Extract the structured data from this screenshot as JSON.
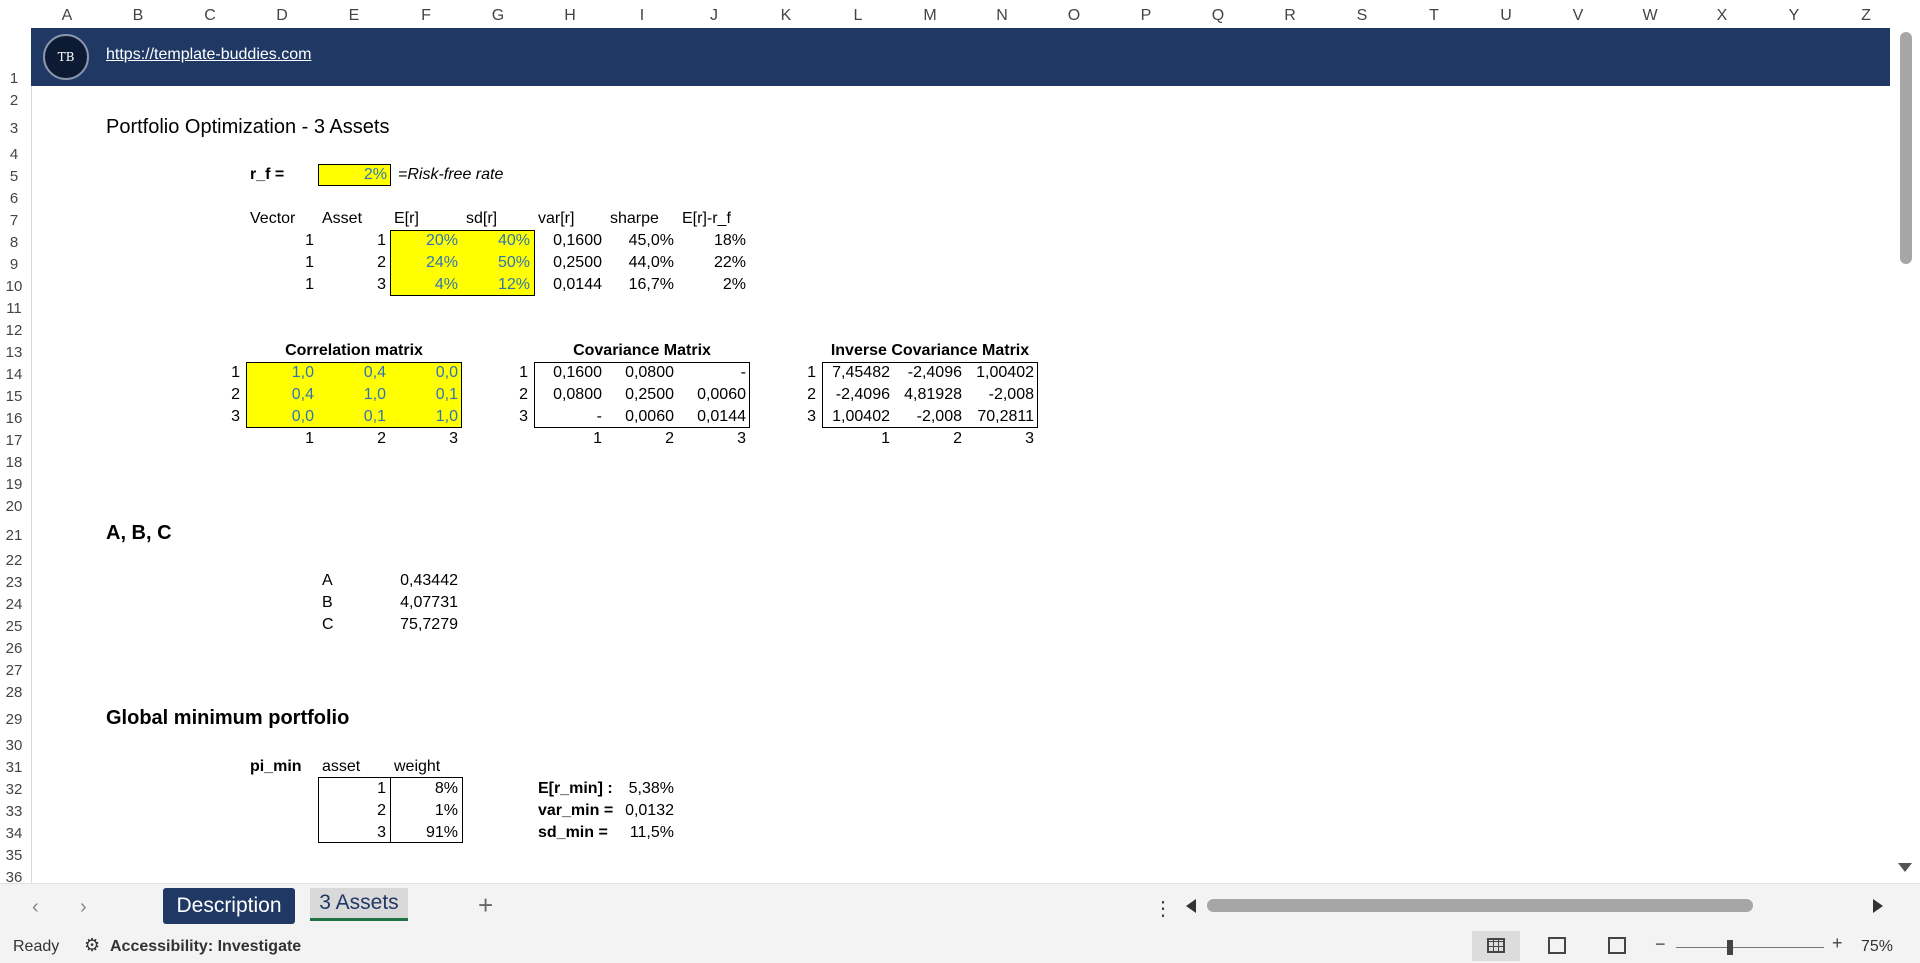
{
  "columns": [
    "A",
    "B",
    "C",
    "D",
    "E",
    "F",
    "G",
    "H",
    "I",
    "J",
    "K",
    "L",
    "M",
    "N",
    "O",
    "P",
    "Q",
    "R",
    "S",
    "T",
    "U",
    "V",
    "W",
    "X",
    "Y",
    "Z"
  ],
  "rows": [
    "1",
    "2",
    "3",
    "4",
    "5",
    "6",
    "7",
    "8",
    "9",
    "10",
    "11",
    "12",
    "13",
    "14",
    "15",
    "16",
    "17",
    "18",
    "19",
    "20",
    "21",
    "22",
    "23",
    "24",
    "25",
    "26",
    "27",
    "28",
    "29",
    "30",
    "31",
    "32",
    "33",
    "34",
    "35",
    "36"
  ],
  "banner": {
    "logo_text": "TB",
    "url": "https://template-buddies.com"
  },
  "title": "Portfolio Optimization - 3 Assets",
  "rf": {
    "label": "r_f =",
    "value": "2%",
    "note": "=Risk-free rate"
  },
  "assets_table": {
    "headers": [
      "Vector",
      "Asset",
      "E[r]",
      "sd[r]",
      "var[r]",
      "sharpe",
      "E[r]-r_f"
    ],
    "rows": [
      [
        "1",
        "1",
        "20%",
        "40%",
        "0,1600",
        "45,0%",
        "18%"
      ],
      [
        "1",
        "2",
        "24%",
        "50%",
        "0,2500",
        "44,0%",
        "22%"
      ],
      [
        "1",
        "3",
        "4%",
        "12%",
        "0,0144",
        "16,7%",
        "2%"
      ]
    ]
  },
  "correlation": {
    "title": "Correlation matrix",
    "row_labels": [
      "1",
      "2",
      "3"
    ],
    "col_labels": [
      "1",
      "2",
      "3"
    ],
    "cells": [
      [
        "1,0",
        "0,4",
        "0,0"
      ],
      [
        "0,4",
        "1,0",
        "0,1"
      ],
      [
        "0,0",
        "0,1",
        "1,0"
      ]
    ]
  },
  "covariance": {
    "title": "Covariance Matrix",
    "row_labels": [
      "1",
      "2",
      "3"
    ],
    "col_labels": [
      "1",
      "2",
      "3"
    ],
    "cells": [
      [
        "0,1600",
        "0,0800",
        "-"
      ],
      [
        "0,0800",
        "0,2500",
        "0,0060"
      ],
      [
        "-",
        "0,0060",
        "0,0144"
      ]
    ]
  },
  "inverse": {
    "title": "Inverse Covariance Matrix",
    "row_labels": [
      "1",
      "2",
      "3"
    ],
    "col_labels": [
      "1",
      "2",
      "3"
    ],
    "cells": [
      [
        "7,45482",
        "-2,4096",
        "1,00402"
      ],
      [
        "-2,4096",
        "4,81928",
        "-2,008"
      ],
      [
        "1,00402",
        "-2,008",
        "70,2811"
      ]
    ]
  },
  "abc": {
    "title": "A, B, C",
    "rows": [
      [
        "A",
        "0,43442"
      ],
      [
        "B",
        "4,07731"
      ],
      [
        "C",
        "75,7279"
      ]
    ]
  },
  "gmp": {
    "title": "Global minimum portfolio",
    "label": "pi_min",
    "headers": [
      "asset",
      "weight"
    ],
    "rows": [
      [
        "1",
        "8%"
      ],
      [
        "2",
        "1%"
      ],
      [
        "3",
        "91%"
      ]
    ],
    "stats": [
      [
        "E[r_min] :",
        "5,38%"
      ],
      [
        "var_min =",
        "0,0132"
      ],
      [
        "sd_min =",
        "11,5%"
      ]
    ]
  },
  "tabs": {
    "description": "Description",
    "active": "3 Assets",
    "add": "+"
  },
  "status": {
    "ready": "Ready",
    "accessibility": "Accessibility: Investigate",
    "zoom": "75%"
  }
}
